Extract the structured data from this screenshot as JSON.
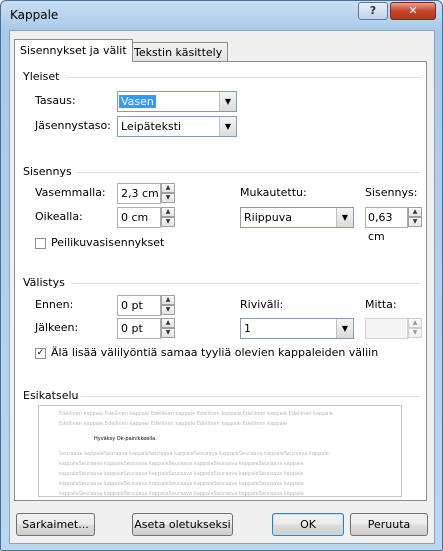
{
  "window": {
    "title": "Kappale",
    "help": "?",
    "close": "✕"
  },
  "tabs": [
    {
      "label": "Sisennykset ja välit"
    },
    {
      "label": "Tekstin käsittely"
    }
  ],
  "general": {
    "heading": "Yleiset",
    "alignment_label": "Tasaus:",
    "alignment_value": "Vasen",
    "outline_label": "Jäsennystaso:",
    "outline_value": "Leipäteksti"
  },
  "indent": {
    "heading": "Sisennys",
    "left_label": "Vasemmalla:",
    "left_value": "2,3 cm",
    "right_label": "Oikealla:",
    "right_value": "0 cm",
    "special_label": "Mukautettu:",
    "special_value": "Riippuva",
    "by_label": "Sisennys:",
    "by_value": "0,63 cm",
    "mirror_label": "Peilikuvasisennykset",
    "mirror_checked": false
  },
  "spacing": {
    "heading": "Välistys",
    "before_label": "Ennen:",
    "before_value": "0 pt",
    "after_label": "Jälkeen:",
    "after_value": "0 pt",
    "line_label": "Riviväli:",
    "line_value": "1",
    "at_label": "Mitta:",
    "at_value": "",
    "no_space_label": "Älä lisää välilyöntiä samaa tyyliä olevien kappaleiden väliin",
    "no_space_checked": true
  },
  "preview": {
    "heading": "Esikatselu",
    "prev_lines": [
      "Edellinen kappale Edellinen kappale Edellinen kappale Edellinen kappale Edellinen kappale Edellinen kappale",
      "Edellinen kappale Edellinen kappale Edellinen kappale Edellinen kappale Edellinen kappale"
    ],
    "current": "Hyväksy Ok-painikkeella.",
    "next_lines": [
      "Seuraava kappaleSeuraava kappaleSeuraava kappaleSeuraava kappaleSeuraava kappaleSeuraava kappale",
      "kappaleSeuraava kappaleSeuraava kappaleSeuraava kappaleSeuraava kappaleSeuraava kappale",
      "kappaleSeuraava kappaleSeuraava kappaleSeuraava kappaleSeuraava kappaleSeuraava kappale",
      "kappaleSeuraava kappaleSeuraava kappaleSeuraava kappaleSeuraava kappaleSeuraava kappale",
      "kappaleSeuraava kappaleSeuraava kappaleSeuraava kappaleSeuraava kappaleSeuraava kappale"
    ]
  },
  "buttons": {
    "tabs": "Sarkaimet...",
    "default": "Aseta oletukseksi",
    "ok": "OK",
    "cancel": "Peruuta"
  }
}
